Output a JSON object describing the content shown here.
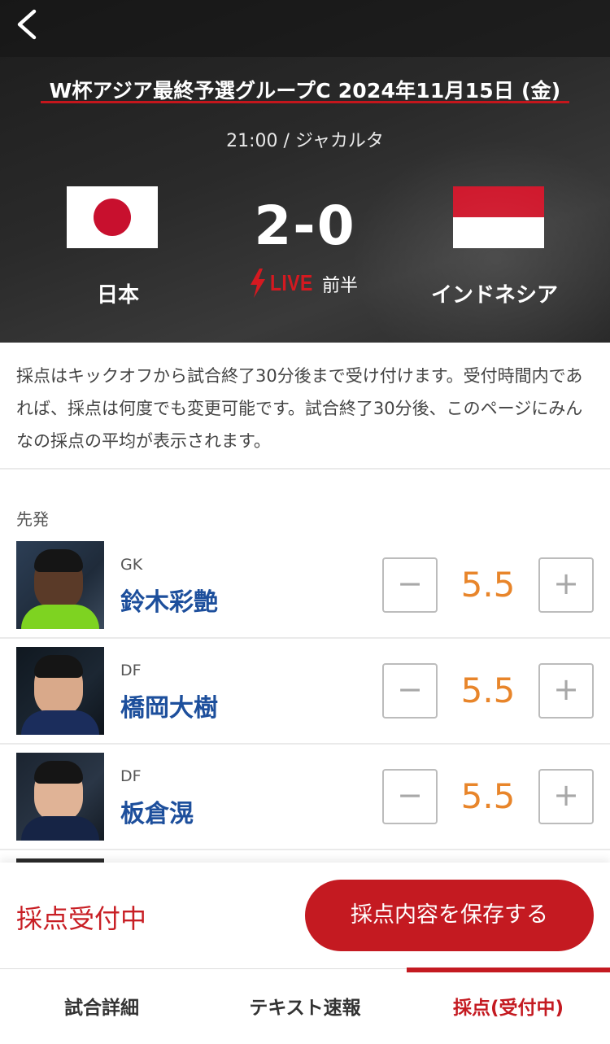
{
  "match": {
    "competition": "W杯アジア最終予選グループC 2024年11月15日 (金)",
    "kickoff": "21:00 / ジャカルタ",
    "home_team": "日本",
    "away_team": "インドネシア",
    "score": "2-0",
    "live_label": "LIVE",
    "period": "前半"
  },
  "notice": "採点はキックオフから試合終了30分後まで受け付けます。受付時間内であれば、採点は何度でも変更可能です。試合終了30分後、このページにみんなの採点の平均が表示されます。",
  "section_label": "先発",
  "players": [
    {
      "position": "GK",
      "name": "鈴木彩艶",
      "score": "5.5"
    },
    {
      "position": "DF",
      "name": "橋岡大樹",
      "score": "5.5"
    },
    {
      "position": "DF",
      "name": "板倉滉",
      "score": "5.5"
    }
  ],
  "stepper": {
    "minus": "−",
    "plus": "+"
  },
  "action_bar": {
    "status": "採点受付中",
    "save_label": "採点内容を保存する"
  },
  "tabs": [
    {
      "label": "試合詳細"
    },
    {
      "label": "テキスト速報"
    },
    {
      "label": "採点(受付中)"
    }
  ],
  "colors": {
    "accent_red": "#c41a21",
    "score_orange": "#e8852a",
    "player_name_blue": "#1d4f9c"
  }
}
